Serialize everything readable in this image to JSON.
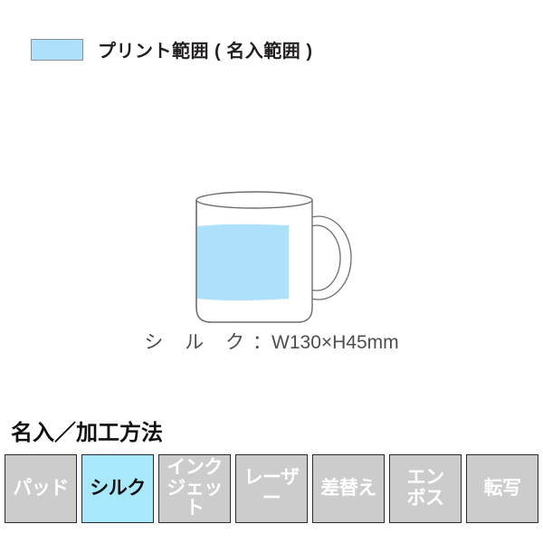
{
  "legend": {
    "swatch_color": "#ade1fb",
    "swatch_border_color": "#8a9298",
    "label": "プリント範囲 ( 名入範囲 )",
    "icon": "print-area-swatch"
  },
  "product": {
    "name": "mug",
    "illustration": "mug-outline",
    "outline_color": "#6d6e71",
    "print_area_color": "#ade1fb",
    "caption_method": "シ ル ク",
    "caption_separator": "：",
    "caption_size": "W130×H45mm",
    "caption_full": "シ ル ク：W130×H45mm"
  },
  "methods": {
    "heading": "名入／加工方法",
    "inactive_color": "#cccccc",
    "inactive_text_color": "#ffffff",
    "active_color": "#a7e9fb",
    "active_text_color": "#111111",
    "items": [
      {
        "id": "pad",
        "lines": [
          "パッド"
        ],
        "active": false
      },
      {
        "id": "silk",
        "lines": [
          "シルク"
        ],
        "active": true
      },
      {
        "id": "inkjet",
        "lines": [
          "インク",
          "ジェット"
        ],
        "active": false
      },
      {
        "id": "laser",
        "lines": [
          "レーザー"
        ],
        "active": false
      },
      {
        "id": "sashikae",
        "lines": [
          "差替え"
        ],
        "active": false
      },
      {
        "id": "emboss",
        "lines": [
          "エン",
          "ボス"
        ],
        "active": false
      },
      {
        "id": "tensha",
        "lines": [
          "転写"
        ],
        "active": false
      }
    ]
  }
}
